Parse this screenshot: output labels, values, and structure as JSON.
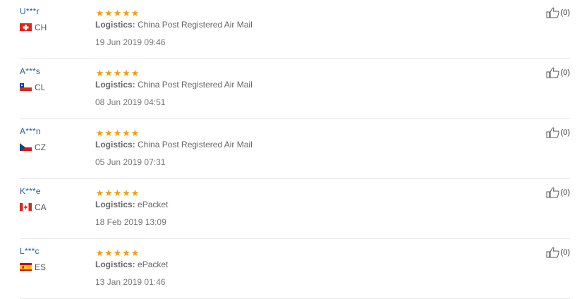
{
  "reviews": [
    {
      "user": "U***r",
      "country": "CH",
      "flag_icon": "switzerland-flag-icon",
      "stars": 5,
      "logistics_label": "Logistics:",
      "logistics_value": "China Post Registered Air Mail",
      "date": "19 Jun 2019 09:46",
      "helpful_count": "(0)"
    },
    {
      "user": "A***s",
      "country": "CL",
      "flag_icon": "chile-flag-icon",
      "stars": 5,
      "logistics_label": "Logistics:",
      "logistics_value": "China Post Registered Air Mail",
      "date": "08 Jun 2019 04:51",
      "helpful_count": "(0)"
    },
    {
      "user": "A***n",
      "country": "CZ",
      "flag_icon": "czech-flag-icon",
      "stars": 5,
      "logistics_label": "Logistics:",
      "logistics_value": "China Post Registered Air Mail",
      "date": "05 Jun 2019 07:31",
      "helpful_count": "(0)"
    },
    {
      "user": "K***e",
      "country": "CA",
      "flag_icon": "canada-flag-icon",
      "stars": 5,
      "logistics_label": "Logistics:",
      "logistics_value": "ePacket",
      "date": "18 Feb 2019 13:09",
      "helpful_count": "(0)"
    },
    {
      "user": "L***c",
      "country": "ES",
      "flag_icon": "spain-flag-icon",
      "stars": 5,
      "logistics_label": "Logistics:",
      "logistics_value": "ePacket",
      "date": "13 Jan 2019 01:46",
      "helpful_count": "(0)"
    }
  ],
  "colors": {
    "username": "#1d5fa8",
    "star": "#f39c12",
    "divider": "#e6e6e6"
  },
  "icons": {
    "star": "star-icon",
    "helpful": "thumbs-up-icon"
  }
}
